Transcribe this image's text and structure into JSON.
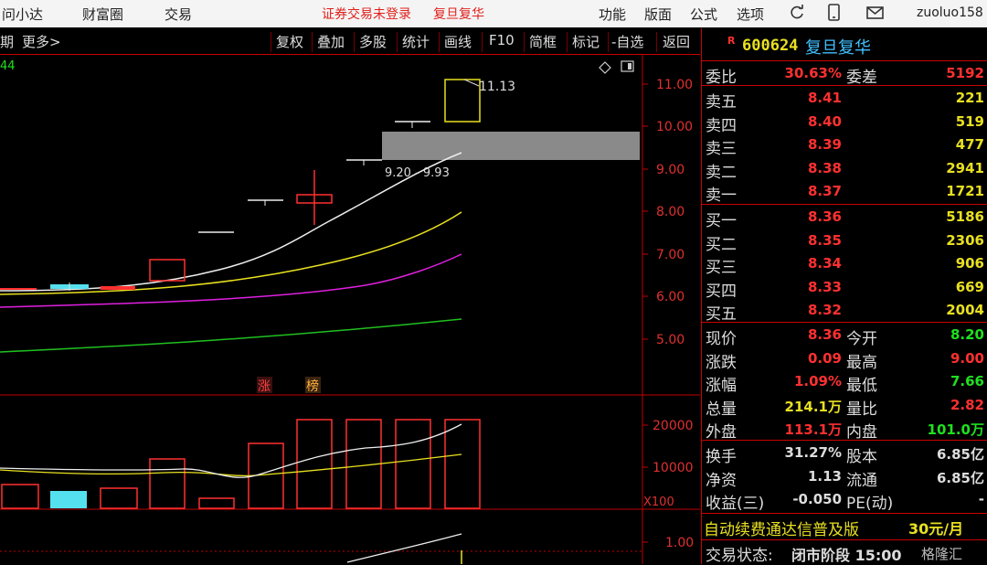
{
  "topbar": {
    "left_items": [
      "问小达",
      "财富圈",
      "交易"
    ],
    "status": "证券交易未登录",
    "stock_name": "复旦复华",
    "menu": [
      "功能",
      "版面",
      "公式",
      "选项"
    ],
    "user": "zuoluo158"
  },
  "toolbar": {
    "left_fragment": "期",
    "more": "更多>",
    "buttons": [
      "复权",
      "叠加",
      "多股",
      "统计",
      "画线",
      "F10",
      "简框",
      "标记",
      "-自选",
      "返回"
    ]
  },
  "chart": {
    "corner_value": "44",
    "price_ticks": [
      "11.00",
      "10.00",
      "9.00",
      "8.00",
      "7.00",
      "6.00",
      "5.00"
    ],
    "high_label": "11.13",
    "range_label": "9.20 - 9.93",
    "tag_zhang": "涨",
    "tag_bang": "榜",
    "volume_ticks": [
      "20000",
      "10000"
    ],
    "volume_unit": "X100",
    "lower_tick": "1.00"
  },
  "quote": {
    "flag": "R",
    "code": "600624",
    "name": "复旦复华",
    "weibi_label": "委比",
    "weibi": "30.63%",
    "weicha_label": "委差",
    "weicha": "5192",
    "asks": [
      {
        "label": "卖五",
        "price": "8.41",
        "vol": "221"
      },
      {
        "label": "卖四",
        "price": "8.40",
        "vol": "519"
      },
      {
        "label": "卖三",
        "price": "8.39",
        "vol": "477"
      },
      {
        "label": "卖二",
        "price": "8.38",
        "vol": "2941"
      },
      {
        "label": "卖一",
        "price": "8.37",
        "vol": "1721"
      }
    ],
    "bids": [
      {
        "label": "买一",
        "price": "8.36",
        "vol": "5186"
      },
      {
        "label": "买二",
        "price": "8.35",
        "vol": "2306"
      },
      {
        "label": "买三",
        "price": "8.34",
        "vol": "906"
      },
      {
        "label": "买四",
        "price": "8.33",
        "vol": "669"
      },
      {
        "label": "买五",
        "price": "8.32",
        "vol": "2004"
      }
    ],
    "stats": [
      {
        "l1": "现价",
        "v1": "8.36",
        "c1": "#ff3030",
        "l2": "今开",
        "v2": "8.20",
        "c2": "#20e020"
      },
      {
        "l1": "涨跌",
        "v1": "0.09",
        "c1": "#ff3030",
        "l2": "最高",
        "v2": "9.00",
        "c2": "#ff3030"
      },
      {
        "l1": "涨幅",
        "v1": "1.09%",
        "c1": "#ff3030",
        "l2": "最低",
        "v2": "7.66",
        "c2": "#20e020"
      },
      {
        "l1": "总量",
        "v1": "214.1万",
        "c1": "#e8e020",
        "l2": "量比",
        "v2": "2.82",
        "c2": "#ff3030"
      },
      {
        "l1": "外盘",
        "v1": "113.1万",
        "c1": "#ff3030",
        "l2": "内盘",
        "v2": "101.0万",
        "c2": "#20e020"
      }
    ],
    "stats2": [
      {
        "l1": "换手",
        "v1": "31.27%",
        "l2": "股本",
        "v2": "6.85亿"
      },
      {
        "l1": "净资",
        "v1": "1.13",
        "l2": "流通",
        "v2": "6.85亿"
      },
      {
        "l1": "收益(三)",
        "v1": "-0.050",
        "l2": "PE(动)",
        "v2": "-"
      }
    ],
    "promo": "自动续费通达信普及版",
    "promo_price": "30元/月",
    "trade_status_label": "交易状态:",
    "trade_status": "闭市阶段 15:00",
    "watermark": "格隆汇"
  },
  "colors": {
    "up": "#ff3030",
    "down": "#20e020",
    "axis": "#c00000",
    "vol_yellow": "#e8e020"
  }
}
